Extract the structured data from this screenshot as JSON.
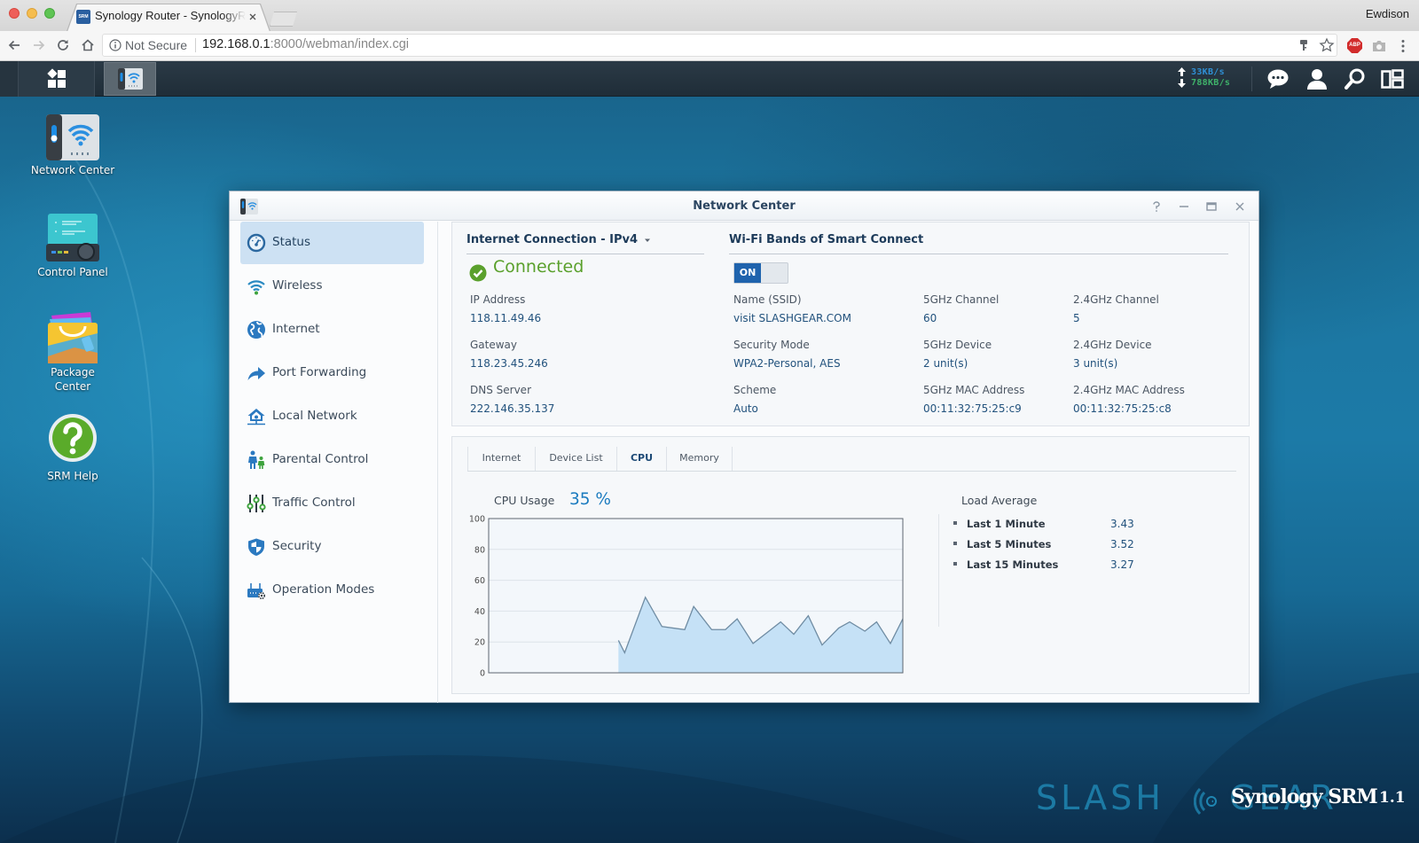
{
  "browser": {
    "tab": {
      "favicon_text": "SRM",
      "title": "Synology Router - SynologyRo"
    },
    "profile_name": "Ewdison",
    "address": {
      "security_label": "Not Secure",
      "url_host": "192.168.0.1",
      "url_path": ":8000/webman/index.cgi"
    },
    "extensions": {
      "abp_label": "ABP"
    }
  },
  "taskbar": {
    "upload_speed": "33KB/s",
    "download_speed": "788KB/s"
  },
  "desktop": {
    "icons": [
      {
        "label": "Network Center",
        "icon": "network-center-icon"
      },
      {
        "label": "Control Panel",
        "icon": "control-panel-icon"
      },
      {
        "label": "Package Center",
        "icon": "package-center-icon"
      },
      {
        "label": "SRM Help",
        "icon": "help-icon"
      }
    ]
  },
  "window": {
    "title": "Network Center",
    "sidebar": [
      {
        "label": "Status",
        "icon": "gauge-icon",
        "selected": true
      },
      {
        "label": "Wireless",
        "icon": "wifi-icon"
      },
      {
        "label": "Internet",
        "icon": "globe-icon"
      },
      {
        "label": "Port Forwarding",
        "icon": "forward-arrow-icon"
      },
      {
        "label": "Local Network",
        "icon": "house-network-icon"
      },
      {
        "label": "Parental Control",
        "icon": "parent-child-icon"
      },
      {
        "label": "Traffic Control",
        "icon": "sliders-icon"
      },
      {
        "label": "Security",
        "icon": "shield-icon"
      },
      {
        "label": "Operation Modes",
        "icon": "router-gear-icon"
      }
    ],
    "internet": {
      "header": "Internet Connection - IPv4",
      "status": "Connected",
      "fields": [
        {
          "label": "IP Address",
          "value": "118.11.49.46"
        },
        {
          "label": "Gateway",
          "value": "118.23.45.246"
        },
        {
          "label": "DNS Server",
          "value": "222.146.35.137"
        }
      ]
    },
    "wifi": {
      "header": "Wi-Fi Bands of Smart Connect",
      "toggle_label": "ON",
      "enabled": true,
      "fields": [
        {
          "label": "Name (SSID)",
          "value": "visit SLASHGEAR.COM"
        },
        {
          "label": "5GHz Channel",
          "value": "60"
        },
        {
          "label": "2.4GHz Channel",
          "value": "5"
        },
        {
          "label": "Security Mode",
          "value": "WPA2-Personal, AES"
        },
        {
          "label": "5GHz Device",
          "value": "2 unit(s)"
        },
        {
          "label": "2.4GHz Device",
          "value": "3 unit(s)"
        },
        {
          "label": "Scheme",
          "value": "Auto"
        },
        {
          "label": "5GHz MAC Address",
          "value": "00:11:32:75:25:c9"
        },
        {
          "label": "2.4GHz MAC Address",
          "value": "00:11:32:75:25:c8"
        }
      ]
    },
    "tabs": [
      {
        "label": "Internet"
      },
      {
        "label": "Device List"
      },
      {
        "label": "CPU",
        "active": true
      },
      {
        "label": "Memory"
      }
    ],
    "cpu": {
      "label": "CPU Usage",
      "value": "35 %"
    },
    "load": {
      "title": "Load Average",
      "rows": [
        {
          "label": "Last 1 Minute",
          "value": "3.43"
        },
        {
          "label": "Last 5 Minutes",
          "value": "3.52"
        },
        {
          "label": "Last 15 Minutes",
          "value": "3.27"
        }
      ]
    }
  },
  "watermark": {
    "brand_left": "SLASH",
    "brand_right": "GEAR",
    "product": "Synology SRM",
    "version": "1.1"
  },
  "colors": {
    "accent": "#1f63ad",
    "connected": "#5aa02c",
    "cpu_value": "#1b7bbf",
    "upload": "#2f90d6",
    "download": "#3fb36a",
    "chart_fill": "#c5e1f6",
    "chart_line": "#6f8ca3"
  },
  "chart_data": {
    "type": "area",
    "title": "CPU Usage",
    "current_value_percent": 35,
    "xlabel": "",
    "ylabel": "",
    "xlim": [
      0,
      60
    ],
    "ylim": [
      0,
      100
    ],
    "yticks": [
      0,
      20,
      40,
      60,
      80,
      100
    ],
    "grid": true,
    "legend": "none",
    "x": [
      18.8,
      19.7,
      22.7,
      25.1,
      28.4,
      29.7,
      32.3,
      34.3,
      36.0,
      38.3,
      40.6,
      42.3,
      44.2,
      46.3,
      48.3,
      50.7,
      52.3,
      54.5,
      56.2,
      58.2,
      60
    ],
    "series": [
      {
        "name": "CPU Usage (%)",
        "values": [
          21,
          13,
          49,
          30,
          28,
          43,
          28,
          28,
          35,
          19,
          27,
          33,
          25,
          37,
          18,
          29,
          33,
          27,
          33,
          19,
          35
        ]
      }
    ]
  }
}
